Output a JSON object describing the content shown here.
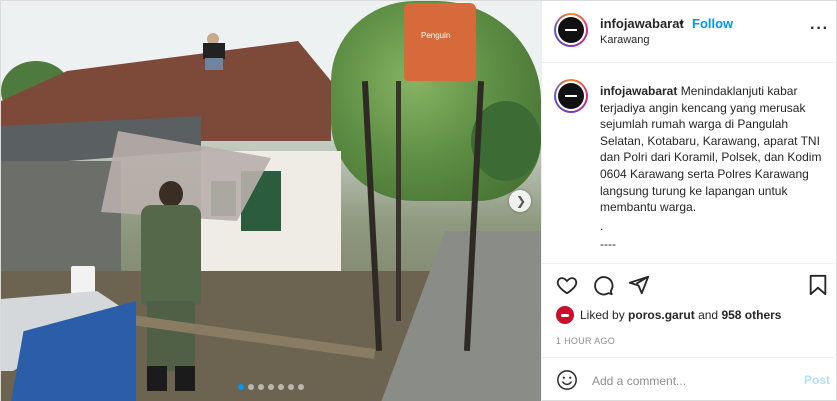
{
  "account": {
    "username": "infojawabarat",
    "separator": "•",
    "follow_label": "Follow",
    "location": "Karawang",
    "more_label": "···"
  },
  "photo": {
    "tank_brand": "Penguin",
    "carousel_dots": 7,
    "active_dot": 0
  },
  "caption": {
    "username": "infojawabarat",
    "text": "Menindaklanjuti kabar terjadiya angin kencang yang merusak sejumlah rumah warga di Pangulah Selatan, Kotabaru, Karawang, aparat TNI dan Polri dari Koramil, Polsek, dan Kodim 0604 Karawang serta Polres Karawang langsung turung ke lapangan untuk membantu warga.",
    "line_dot": ".",
    "line_dash": "----"
  },
  "likes": {
    "prefix": "Liked by",
    "user": "poros.garut",
    "and": "and",
    "others": "958 others"
  },
  "time_ago": "1 HOUR AGO",
  "comment": {
    "placeholder": "Add a comment...",
    "post_label": "Post"
  },
  "colors": {
    "accent": "#0095f6",
    "post_disabled": "#b2dffc",
    "muted": "#8e8e8e",
    "text": "#262626"
  },
  "icons": {
    "like": "heart-icon",
    "comment": "comment-icon",
    "share": "paper-plane-icon",
    "save": "bookmark-icon",
    "emoji": "smiley-icon",
    "next": "chevron-right-icon",
    "more": "more-horizontal-icon"
  }
}
